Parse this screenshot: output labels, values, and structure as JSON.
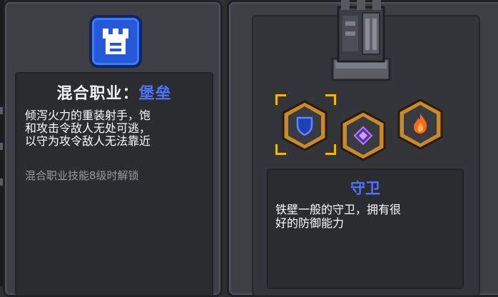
{
  "class_panel": {
    "icon": "castle-tower-icon",
    "title_prefix": "混合职业：",
    "title_name": "堡垒",
    "description_lines": [
      "倾泻火力的重装射手，饱",
      "和攻击令敌人无处可逃，",
      "以守为攻令敌人无法靠近"
    ],
    "unlock_note": "混合职业技能8级时解锁"
  },
  "skill_panel": {
    "skills": [
      {
        "icon": "shield-icon",
        "selected": true
      },
      {
        "icon": "arcane-sigil-icon",
        "selected": false
      },
      {
        "icon": "flame-icon",
        "selected": false
      }
    ],
    "selected_name": "守卫",
    "selected_description_lines": [
      "铁壁一般的守卫，拥有很",
      "好的防御能力"
    ]
  },
  "colors": {
    "accent_blue": "#4f73ff",
    "skill_frame_gold": "#c98a2e",
    "selection_bracket": "#f2b40f",
    "class_icon_bg": "#2559d8"
  }
}
